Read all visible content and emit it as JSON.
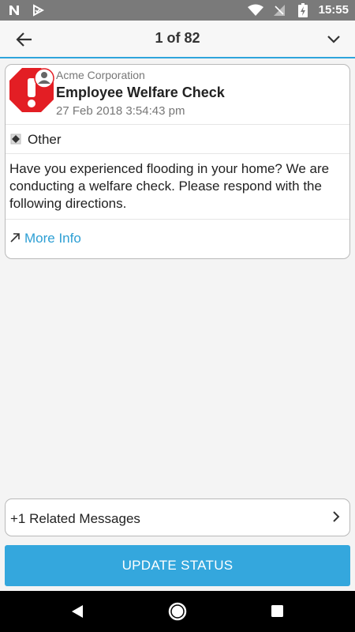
{
  "status_bar": {
    "time": "15:55",
    "icons": [
      "n-icon",
      "play-protect-icon",
      "wifi-icon",
      "no-signal-icon",
      "battery-charging-icon"
    ]
  },
  "app_bar": {
    "back_icon": "arrow-left-icon",
    "pager": "1 of 82",
    "expand_icon": "chevron-down-icon"
  },
  "message": {
    "icon": "alert-octagon-user-icon",
    "sender": "Acme Corporation",
    "subject": "Employee Welfare Check",
    "date": "27 Feb 2018 3:54:43 pm",
    "category_icon": "diamond-icon",
    "category": "Other",
    "body": "Have you experienced flooding in your home? We are conducting a welfare check. Please respond with the following directions.",
    "more_info_icon": "external-link-arrow-icon",
    "more_info_label": "More Info"
  },
  "related": {
    "label": "+1 Related Messages",
    "icon": "chevron-right-icon"
  },
  "update_button": {
    "label": "UPDATE STATUS"
  },
  "nav_bar": {
    "icons": [
      "nav-back-icon",
      "nav-home-icon",
      "nav-recents-icon"
    ]
  },
  "colors": {
    "accent": "#34a7dd",
    "alert_red": "#e31e24",
    "link": "#2d9fd4"
  }
}
